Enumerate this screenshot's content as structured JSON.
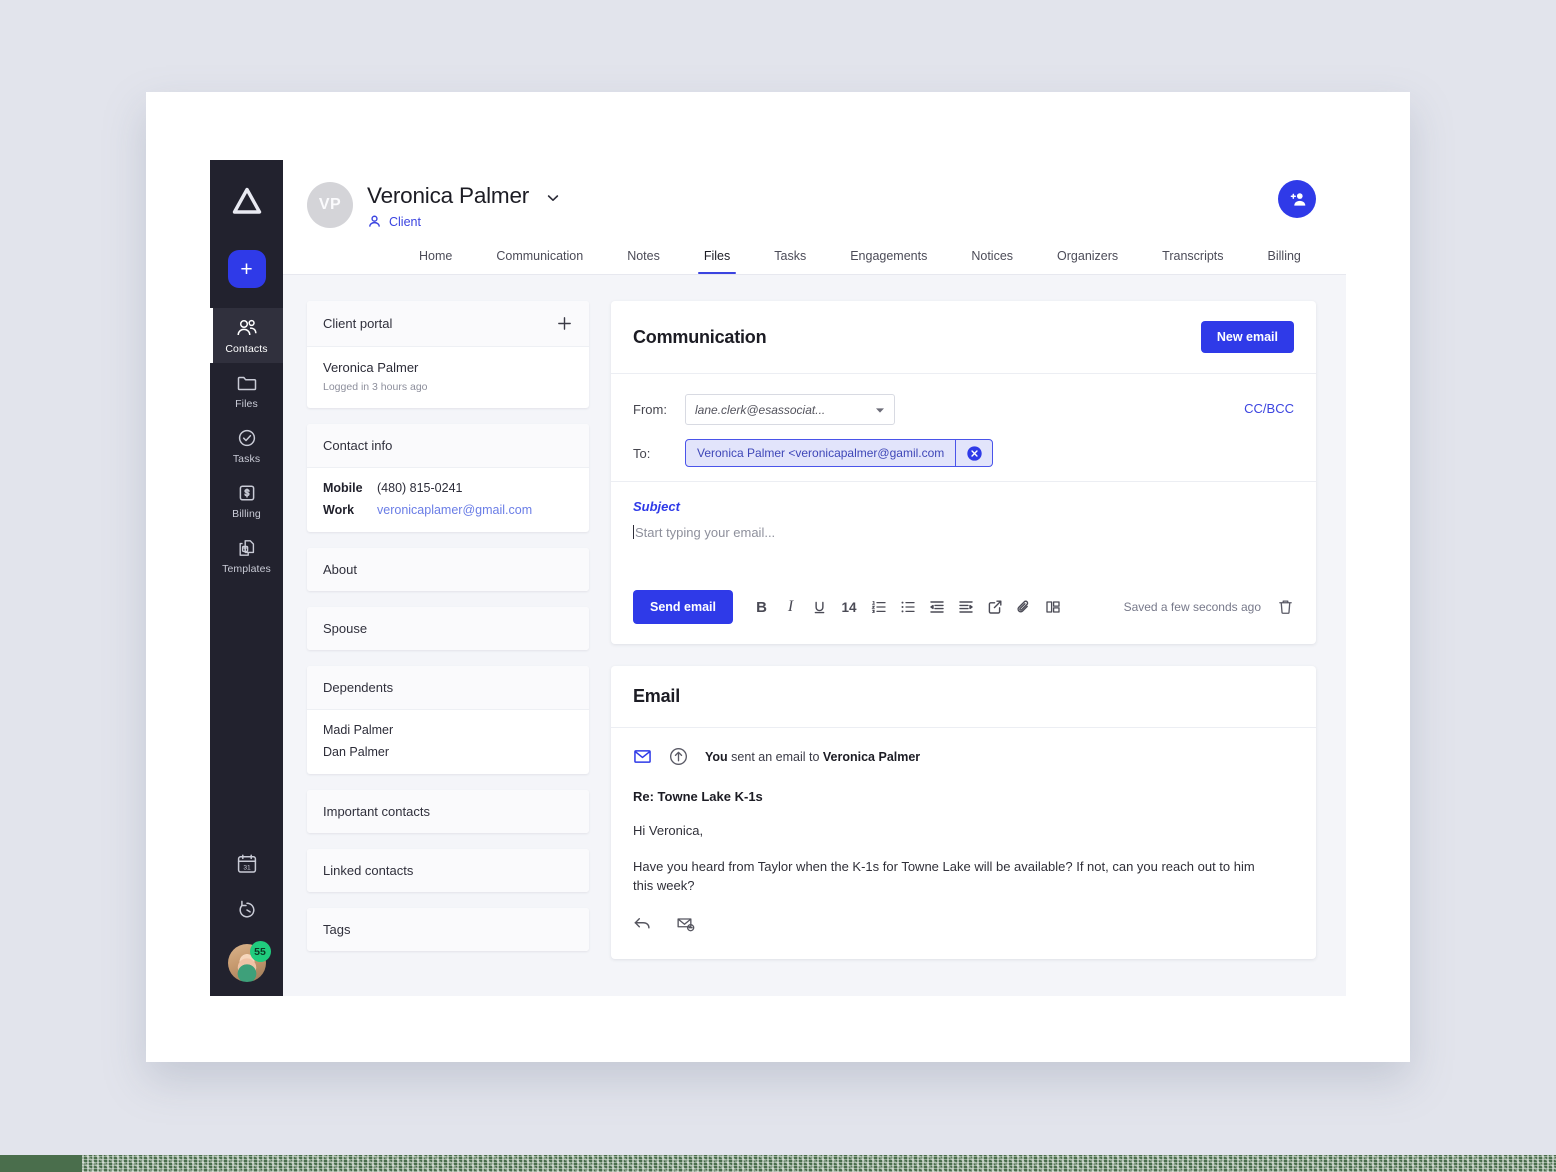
{
  "brand": {
    "accent": "#2f3ae8",
    "link": "#3b44e0",
    "rail_bg": "#22222e",
    "strip_green": "#4a6e4c",
    "logo_name": "triangle-logo"
  },
  "rail": {
    "add_label": "+",
    "items": [
      {
        "label": "Contacts",
        "icon": "contacts-icon",
        "active": true
      },
      {
        "label": "Files",
        "icon": "folder-icon",
        "active": false
      },
      {
        "label": "Tasks",
        "icon": "check-circle-icon",
        "active": false
      },
      {
        "label": "Billing",
        "icon": "billing-icon",
        "active": false
      },
      {
        "label": "Templates",
        "icon": "templates-icon",
        "active": false
      }
    ],
    "bottom": [
      {
        "icon": "calendar-icon",
        "day": "31"
      },
      {
        "icon": "timer-icon"
      }
    ],
    "avatar_badge": "55"
  },
  "header": {
    "avatar_initials": "VP",
    "contact_name": "Veronica Palmer",
    "role": "Client",
    "add_user_icon": "add-user-icon",
    "chevron_icon": "chevron-down-icon"
  },
  "tabs": [
    {
      "label": "Home",
      "active": false
    },
    {
      "label": "Communication",
      "active": false
    },
    {
      "label": "Notes",
      "active": false
    },
    {
      "label": "Files",
      "active": true
    },
    {
      "label": "Tasks",
      "active": false
    },
    {
      "label": "Engagements",
      "active": false
    },
    {
      "label": "Notices",
      "active": false
    },
    {
      "label": "Organizers",
      "active": false
    },
    {
      "label": "Transcripts",
      "active": false
    },
    {
      "label": "Billing",
      "active": false
    }
  ],
  "left_cards": {
    "client_portal": {
      "title": "Client portal",
      "add_icon": "plus-icon",
      "person": "Veronica Palmer",
      "status": "Logged in 3 hours ago"
    },
    "contact_info": {
      "title": "Contact info",
      "rows": [
        {
          "key": "Mobile",
          "value": "(480) 815-0241",
          "is_link": false
        },
        {
          "key": "Work",
          "value": "veronicaplamer@gmail.com",
          "is_link": true
        }
      ]
    },
    "about": {
      "title": "About"
    },
    "spouse": {
      "title": "Spouse"
    },
    "dependents": {
      "title": "Dependents",
      "people": [
        "Madi Palmer",
        "Dan Palmer"
      ]
    },
    "important_contacts": {
      "title": "Important contacts"
    },
    "linked_contacts": {
      "title": "Linked contacts"
    },
    "tags": {
      "title": "Tags"
    }
  },
  "communication": {
    "title": "Communication",
    "new_email_label": "New email",
    "from_label": "From:",
    "from_value": "lane.clerk@esassociat...",
    "cc_bcc_label": "CC/BCC",
    "to_label": "To:",
    "to_chip": "Veronica Palmer <veronicapalmer@gamil.com",
    "chip_remove_icon": "close-circle-icon",
    "subject_placeholder": "Subject",
    "body_placeholder": "Start typing your email...",
    "send_label": "Send email",
    "toolbar": [
      {
        "icon": "bold-icon",
        "label": "B"
      },
      {
        "icon": "italic-icon",
        "label": "I"
      },
      {
        "icon": "underline-icon",
        "label": "U"
      },
      {
        "icon": "font-size-icon",
        "label": "14"
      },
      {
        "icon": "ordered-list-icon",
        "label": ""
      },
      {
        "icon": "bullet-list-icon",
        "label": ""
      },
      {
        "icon": "outdent-icon",
        "label": ""
      },
      {
        "icon": "indent-icon",
        "label": ""
      },
      {
        "icon": "external-link-icon",
        "label": ""
      },
      {
        "icon": "attachment-icon",
        "label": ""
      },
      {
        "icon": "template-icon",
        "label": ""
      }
    ],
    "saved_note": "Saved a few seconds ago",
    "delete_icon": "trash-icon"
  },
  "email_card": {
    "title": "Email",
    "envelope_icon": "envelope-icon",
    "sent_icon": "sent-arrow-icon",
    "meta_prefix": "You",
    "meta_middle": " sent an email to ",
    "meta_recipient": "Veronica Palmer",
    "subject": "Re: Towne Lake K-1s",
    "greeting": "Hi Veronica,",
    "paragraph": "Have you heard from Taylor when the K-1s for Towne Lake will be available? If not, can you reach out to him this week?",
    "actions": [
      {
        "icon": "reply-icon"
      },
      {
        "icon": "mark-unread-icon"
      }
    ]
  }
}
